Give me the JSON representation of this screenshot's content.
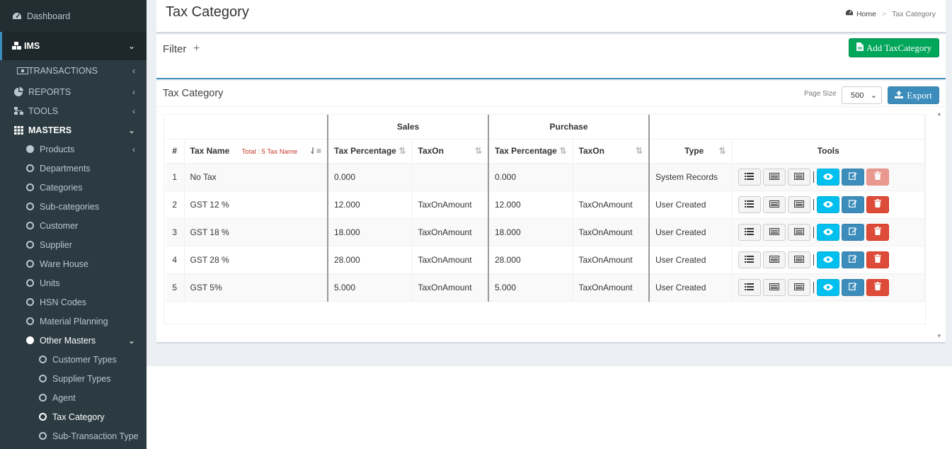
{
  "sidebar": {
    "dashboard": "Dashboard",
    "ims": "IMS",
    "transactions": "TRANSACTIONS",
    "reports": "REPORTS",
    "tools": "TOOLS",
    "masters": "MASTERS",
    "items": [
      "Products",
      "Departments",
      "Categories",
      "Sub-categories",
      "Customer",
      "Supplier",
      "Ware House",
      "Units",
      "HSN Codes",
      "Material Planning"
    ],
    "other_masters": "Other Masters",
    "other_items": [
      "Customer Types",
      "Supplier Types",
      "Agent",
      "Tax Category",
      "Sub-Transaction Type"
    ]
  },
  "header": {
    "title": "Tax Category",
    "breadcrumb_home": "Home",
    "breadcrumb_sep": ">",
    "breadcrumb_current": "Tax Category"
  },
  "filter": {
    "label": "Filter",
    "plus": "+",
    "add_button": "Add TaxCategory"
  },
  "table_box": {
    "title": "Tax Category",
    "page_size_label": "Page Size",
    "page_size_value": "500",
    "export_button": "Export"
  },
  "table": {
    "group_sales": "Sales",
    "group_purchase": "Purchase",
    "col_index": "#",
    "col_tax_name": "Tax Name",
    "total_note": "Total : 5 Tax Name",
    "col_tax_percentage": "Tax Percentage",
    "col_taxon": "TaxOn",
    "col_type": "Type",
    "col_tools": "Tools",
    "rows": [
      {
        "idx": "1",
        "name": "No Tax",
        "sales_pct": "0.000",
        "sales_on": "",
        "pur_pct": "0.000",
        "pur_on": "",
        "type": "System Records"
      },
      {
        "idx": "2",
        "name": "GST 12 %",
        "sales_pct": "12.000",
        "sales_on": "TaxOnAmount",
        "pur_pct": "12.000",
        "pur_on": "TaxOnAmount",
        "type": "User Created"
      },
      {
        "idx": "3",
        "name": "GST 18 %",
        "sales_pct": "18.000",
        "sales_on": "TaxOnAmount",
        "pur_pct": "18.000",
        "pur_on": "TaxOnAmount",
        "type": "User Created"
      },
      {
        "idx": "4",
        "name": "GST 28 %",
        "sales_pct": "28.000",
        "sales_on": "TaxOnAmount",
        "pur_pct": "28.000",
        "pur_on": "TaxOnAmount",
        "type": "User Created"
      },
      {
        "idx": "5",
        "name": "GST 5%",
        "sales_pct": "5.000",
        "sales_on": "TaxOnAmount",
        "pur_pct": "5.000",
        "pur_on": "TaxOnAmount",
        "type": "User Created"
      }
    ]
  },
  "colors": {
    "sidebar_bg": "#2c3b41",
    "accent_blue": "#3c8dbc",
    "success_green": "#00a65a",
    "info_cyan": "#00c0ef",
    "danger_red": "#dd4b39"
  }
}
